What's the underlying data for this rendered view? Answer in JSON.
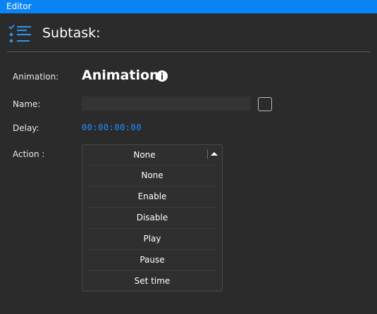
{
  "window": {
    "title": "Editor"
  },
  "header": {
    "title": "Subtask:",
    "icon": "checklist-icon"
  },
  "form": {
    "animation_label": "Animation:",
    "animation_value": "Animation",
    "name_label": "Name:",
    "name_value": "",
    "delay_label": "Delay:",
    "delay_value": "00:00:00:00",
    "action_label": "Action :"
  },
  "dropdown": {
    "selected": "None",
    "options": [
      "None",
      "Enable",
      "Disable",
      "Play",
      "Pause",
      "Set time"
    ]
  },
  "colors": {
    "accent": "#0a84f5",
    "background": "#2b2b2b",
    "delay_text": "#1e90ff"
  }
}
